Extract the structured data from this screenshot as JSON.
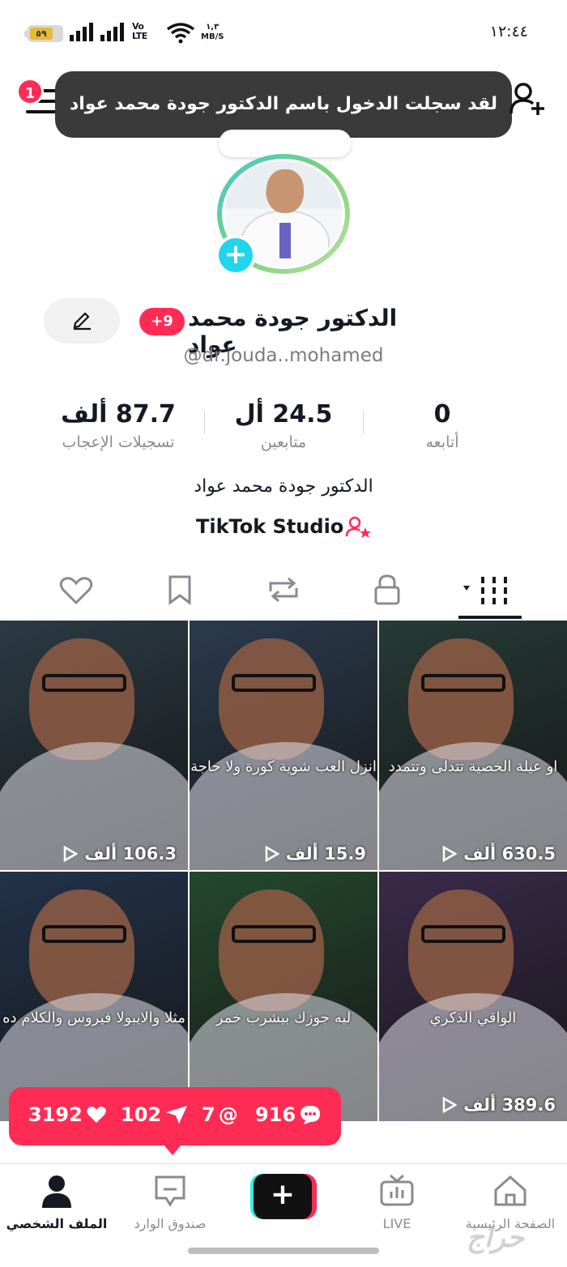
{
  "status_bar": {
    "battery": "٥٩",
    "network": "Vo\nLTE",
    "speed": "١,٣\nMB/S",
    "time": "١٢:٤٤"
  },
  "header": {
    "menu_badge": "1",
    "toast": "لقد سجلت الدخول باسم الدكتور جودة محمد عواد"
  },
  "profile": {
    "display_name": "الدكتور جودة محمد عواد",
    "badge": "+9",
    "username": "@dr.jouda..mohamed",
    "bio": "الدكتور جودة محمد عواد",
    "studio_label": "TikTok Studio"
  },
  "stats": [
    {
      "value": "87.7 ألف",
      "label": "تسجيلات الإعجاب"
    },
    {
      "value": "24.5 أل",
      "label": "متابعين"
    },
    {
      "value": "0",
      "label": "أتابعه"
    }
  ],
  "tabs": [
    "likes-icon",
    "favorites-icon",
    "repost-icon",
    "private-icon",
    "videos-grid-icon"
  ],
  "videos": [
    {
      "caption": "",
      "views": "106.3 ألف",
      "bg": "#2b3a44"
    },
    {
      "caption": "انزل العب شوية كورة ولا حاجة",
      "views": "15.9 ألف",
      "bg": "#2a3a4e"
    },
    {
      "caption": "او عيلة الخصية تتدلى وتتمدد",
      "views": "630.5 ألف",
      "bg": "#263a36"
    },
    {
      "caption": "مثلا والايبولا فيروس والكلام ده",
      "views": "",
      "bg": "#22324a"
    },
    {
      "caption": "ليه جوزك بيشرب خمر",
      "views": "",
      "bg": "#24482e"
    },
    {
      "caption": "الواقي الذكري",
      "views": "389.6 ألف",
      "bg": "#3a2a4a"
    }
  ],
  "interaction_bar": {
    "likes": "3192",
    "shares": "102",
    "mentions": "7",
    "comments": "916"
  },
  "bottom_nav": {
    "profile": "الملف الشخصي",
    "inbox": "صندوق الوارد",
    "live": "LIVE",
    "home": "الصفحة الرئيسية"
  },
  "colors": {
    "accent": "#fe2c55",
    "cyan": "#25f4ee",
    "text": "#161823",
    "muted": "#8a8b91"
  }
}
